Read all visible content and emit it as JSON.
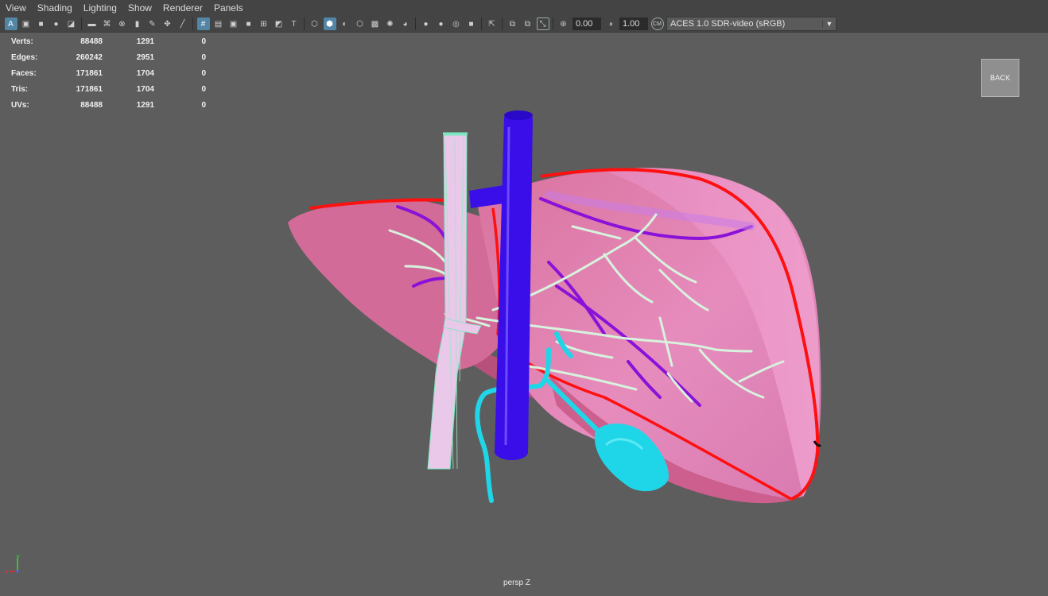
{
  "menu": [
    "View",
    "Shading",
    "Lighting",
    "Show",
    "Renderer",
    "Panels"
  ],
  "toolbar": {
    "exposure": "0.00",
    "gamma": "1.00",
    "colorspace": "ACES 1.0 SDR-video (sRGB)",
    "icons": [
      "select-camera-icon",
      "camera-attributes-icon",
      "bookmarks-icon",
      "image-plane-icon",
      "2d-pan-zoom-icon",
      "grease-pencil-icon",
      "grid-icon",
      "film-gate-icon",
      "resolution-gate-icon",
      "gate-mask-icon",
      "field-chart-icon",
      "safe-action-icon",
      "safe-title-icon",
      "wireframe-icon",
      "smooth-shade-icon",
      "default-material-icon",
      "textured-icon",
      "use-all-lights-icon",
      "shadows-icon",
      "ambient-occlusion-icon",
      "motion-blur-icon",
      "anti-alias-icon",
      "depth-of-field-icon",
      "isolate-select-icon",
      "xray-icon",
      "xray-joints-icon",
      "backface-icon",
      "exposure-icon",
      "gamma-icon",
      "color-management-icon"
    ]
  },
  "hud": {
    "rows": [
      {
        "label": "Verts:",
        "v1": "88488",
        "v2": "1291",
        "v3": "0"
      },
      {
        "label": "Edges:",
        "v1": "260242",
        "v2": "2951",
        "v3": "0"
      },
      {
        "label": "Faces:",
        "v1": "171861",
        "v2": "1704",
        "v3": "0"
      },
      {
        "label": "Tris:",
        "v1": "171861",
        "v2": "1704",
        "v3": "0"
      },
      {
        "label": "UVs:",
        "v1": "88488",
        "v2": "1291",
        "v3": "0"
      }
    ]
  },
  "back_button": "BACK",
  "camera_label": "persp Z",
  "axis": {
    "y": "y",
    "x": "x"
  },
  "colors": {
    "viewport_bg": "#5d5d5d",
    "liver": "#e58bb8",
    "liver_dark": "#c9628f",
    "outline": "#ff0000",
    "vena_cava": "#3a0ee8",
    "portal": "#e9c8ea",
    "bile": "#1fd6e8",
    "vessel_light": "#d7f2dd",
    "purple_vessel": "#8a12d8"
  }
}
